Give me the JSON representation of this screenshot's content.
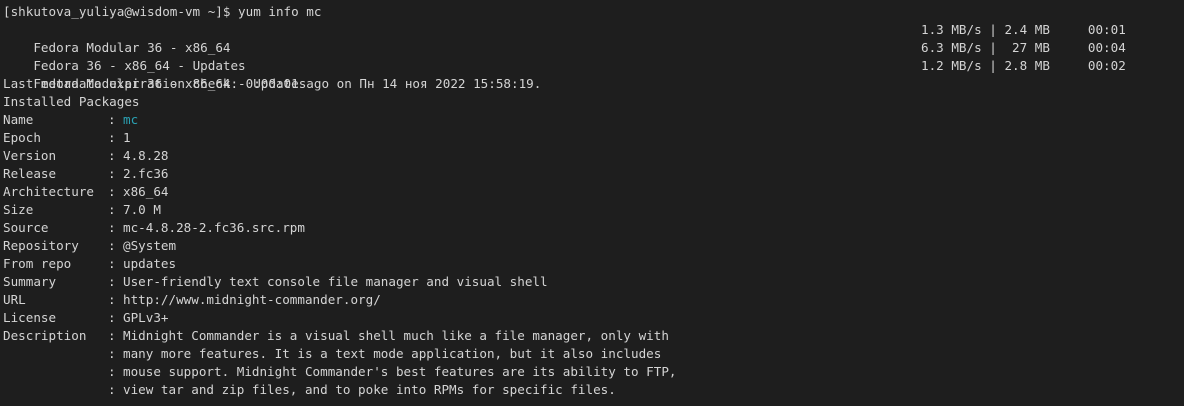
{
  "prompt": {
    "text": "[shkutova_yuliya@wisdom-vm ~]$ yum info mc"
  },
  "repos": [
    {
      "name": "Fedora Modular 36 - x86_64",
      "speed": "1.3 MB/s",
      "size": "2.4 MB",
      "time": "00:01"
    },
    {
      "name": "Fedora 36 - x86_64 - Updates",
      "speed": "6.3 MB/s",
      "size": " 27 MB",
      "time": "00:04"
    },
    {
      "name": "Fedora Modular 36 - x86_64 - Updates",
      "speed": "1.2 MB/s",
      "size": "2.8 MB",
      "time": "00:02"
    }
  ],
  "metadata_line": "Last metadata expiration check: 0:00:01 ago on Пн 14 ноя 2022 15:58:19.",
  "section_title": "Installed Packages",
  "fields": [
    {
      "key": "Name",
      "value": "mc"
    },
    {
      "key": "Epoch",
      "value": "1"
    },
    {
      "key": "Version",
      "value": "4.8.28"
    },
    {
      "key": "Release",
      "value": "2.fc36"
    },
    {
      "key": "Architecture",
      "value": "x86_64"
    },
    {
      "key": "Size",
      "value": "7.0 M"
    },
    {
      "key": "Source",
      "value": "mc-4.8.28-2.fc36.src.rpm"
    },
    {
      "key": "Repository",
      "value": "@System"
    },
    {
      "key": "From repo",
      "value": "updates"
    },
    {
      "key": "Summary",
      "value": "User-friendly text console file manager and visual shell"
    },
    {
      "key": "URL",
      "value": "http://www.midnight-commander.org/"
    },
    {
      "key": "License",
      "value": "GPLv3+"
    },
    {
      "key": "Description",
      "value": "Midnight Commander is a visual shell much like a file manager, only with"
    },
    {
      "key": "",
      "value": "many more features. It is a text mode application, but it also includes"
    },
    {
      "key": "",
      "value": "mouse support. Midnight Commander's best features are its ability to FTP,"
    },
    {
      "key": "",
      "value": "view tar and zip files, and to poke into RPMs for specific files."
    }
  ],
  "separator": ":",
  "pipe": "|",
  "colors": {
    "background": "#1e1e1e",
    "foreground": "#d4d4d4",
    "highlight": "#2aa1b3"
  }
}
